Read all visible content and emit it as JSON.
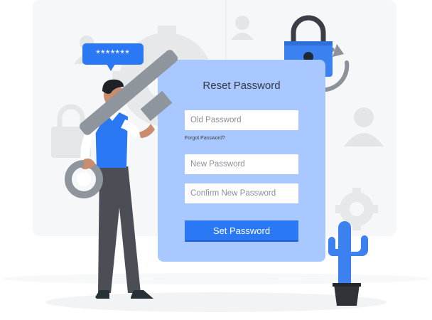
{
  "form": {
    "title": "Reset Password",
    "old_password_placeholder": "Old Password",
    "forgot_link": "Forgot Password?",
    "new_password_placeholder": "New Password",
    "confirm_password_placeholder": "Confirm New Password",
    "submit_label": "Set Password"
  },
  "speech_bubble": {
    "text": "*******"
  },
  "colors": {
    "accent": "#2b78f5",
    "card": "#a9c8ff",
    "card_text": "#333a44",
    "lock_body": "#3b82f0"
  },
  "illustration": {
    "icons": [
      "padlock-icon",
      "refresh-arrows-icon",
      "key-icon",
      "gear-icon",
      "user-silhouette-icon",
      "cactus-icon"
    ]
  }
}
